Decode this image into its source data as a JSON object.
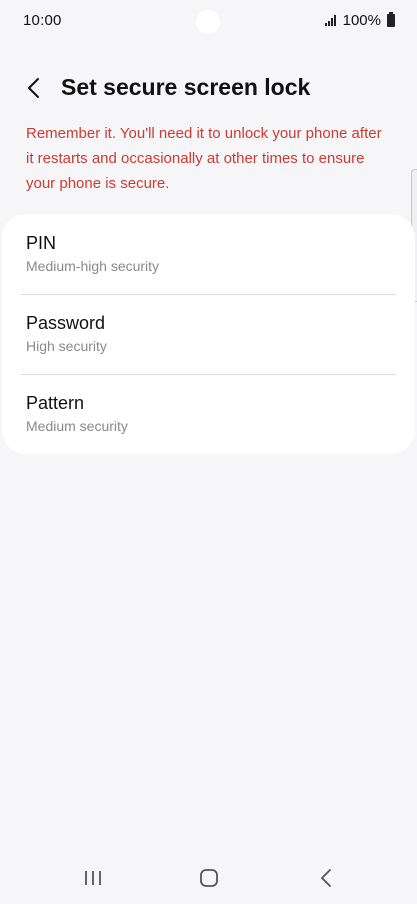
{
  "status_bar": {
    "time": "10:00",
    "battery": "100%",
    "signal_icon": "signal-bars-icon",
    "battery_icon": "battery-icon"
  },
  "header": {
    "title": "Set secure screen lock",
    "back_icon": "chevron-left-icon"
  },
  "warning": {
    "text": "Remember it. You'll need it to unlock your phone after it restarts and occasionally at other times to ensure your phone is secure.",
    "color": "#cc3b32"
  },
  "options": [
    {
      "title": "PIN",
      "subtitle": "Medium-high security"
    },
    {
      "title": "Password",
      "subtitle": "High security"
    },
    {
      "title": "Pattern",
      "subtitle": "Medium security"
    }
  ],
  "nav_bar": {
    "recents_icon": "recent-apps-icon",
    "home_icon": "home-icon",
    "back_icon": "back-icon"
  },
  "colors": {
    "background": "#f6f6f8",
    "card": "#ffffff",
    "text_primary": "#111111",
    "text_secondary": "#8a8a8e",
    "divider": "#dcdcdf"
  }
}
